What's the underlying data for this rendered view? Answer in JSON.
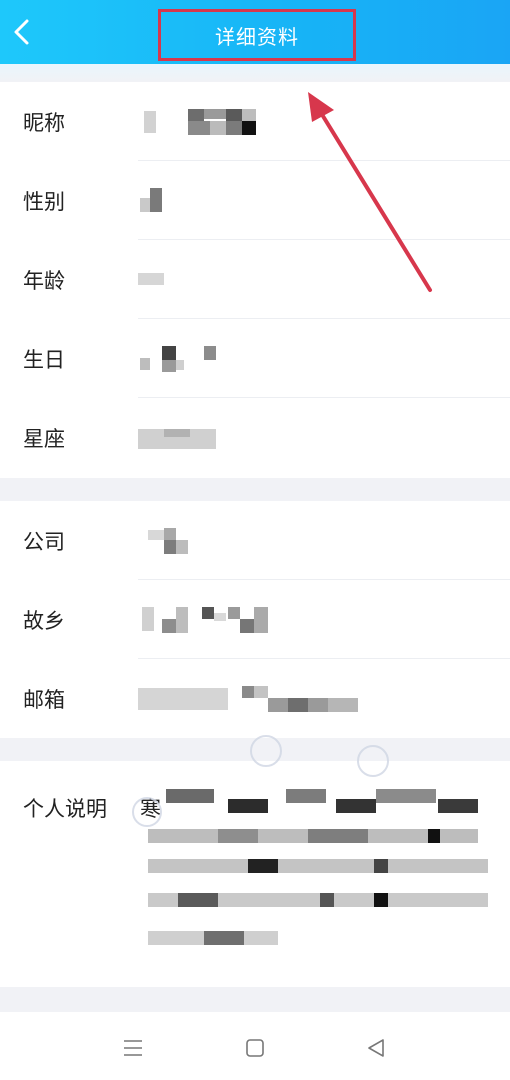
{
  "header": {
    "title": "详细资料",
    "back_icon": "chevron-left-icon"
  },
  "profile": {
    "basic": [
      {
        "key": "nickname",
        "label": "昵称"
      },
      {
        "key": "gender",
        "label": "性别"
      },
      {
        "key": "age",
        "label": "年龄"
      },
      {
        "key": "birthday",
        "label": "生日"
      },
      {
        "key": "zodiac",
        "label": "星座"
      }
    ],
    "extra": [
      {
        "key": "company",
        "label": "公司"
      },
      {
        "key": "hometown",
        "label": "故乡"
      },
      {
        "key": "email",
        "label": "邮箱"
      }
    ],
    "description": {
      "label": "个人说明",
      "first_char": "寒"
    }
  },
  "navbar": {
    "menu_icon": "menu-icon",
    "home_icon": "home-square-icon",
    "back_icon": "triangle-back-icon"
  },
  "colors": {
    "header": "#17b3f6",
    "highlight_box": "#d7374c",
    "arrow": "#d7374c",
    "background": "#f1f2f6"
  }
}
